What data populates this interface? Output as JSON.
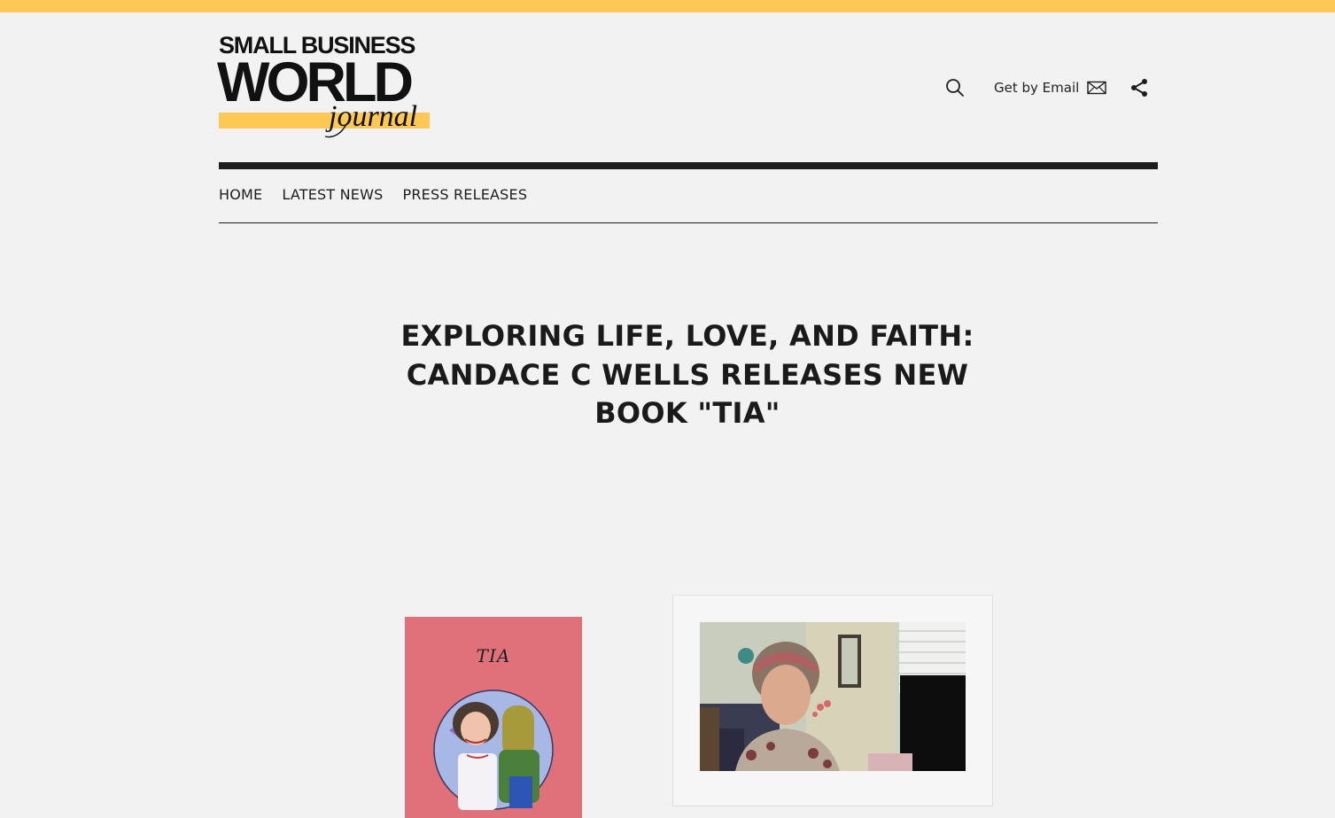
{
  "colors": {
    "accent": "#fdc854",
    "text": "#1d1d1d",
    "background": "#f2f2f2",
    "book_cover": "#e07079"
  },
  "logo": {
    "line1": "SMALL BUSINESS",
    "line2": "WORLD",
    "line3": "journal"
  },
  "header": {
    "search_icon": "search-icon",
    "email_label": "Get by Email",
    "email_icon": "envelope-icon",
    "share_icon": "share-icon"
  },
  "nav": {
    "items": [
      "HOME",
      "LATEST NEWS",
      "PRESS RELEASES"
    ]
  },
  "article": {
    "title": "EXPLORING LIFE, LOVE, AND FAITH: CANDACE C WELLS RELEASES NEW BOOK \"TIA\""
  },
  "images": {
    "book_cover_title": "TIA"
  }
}
